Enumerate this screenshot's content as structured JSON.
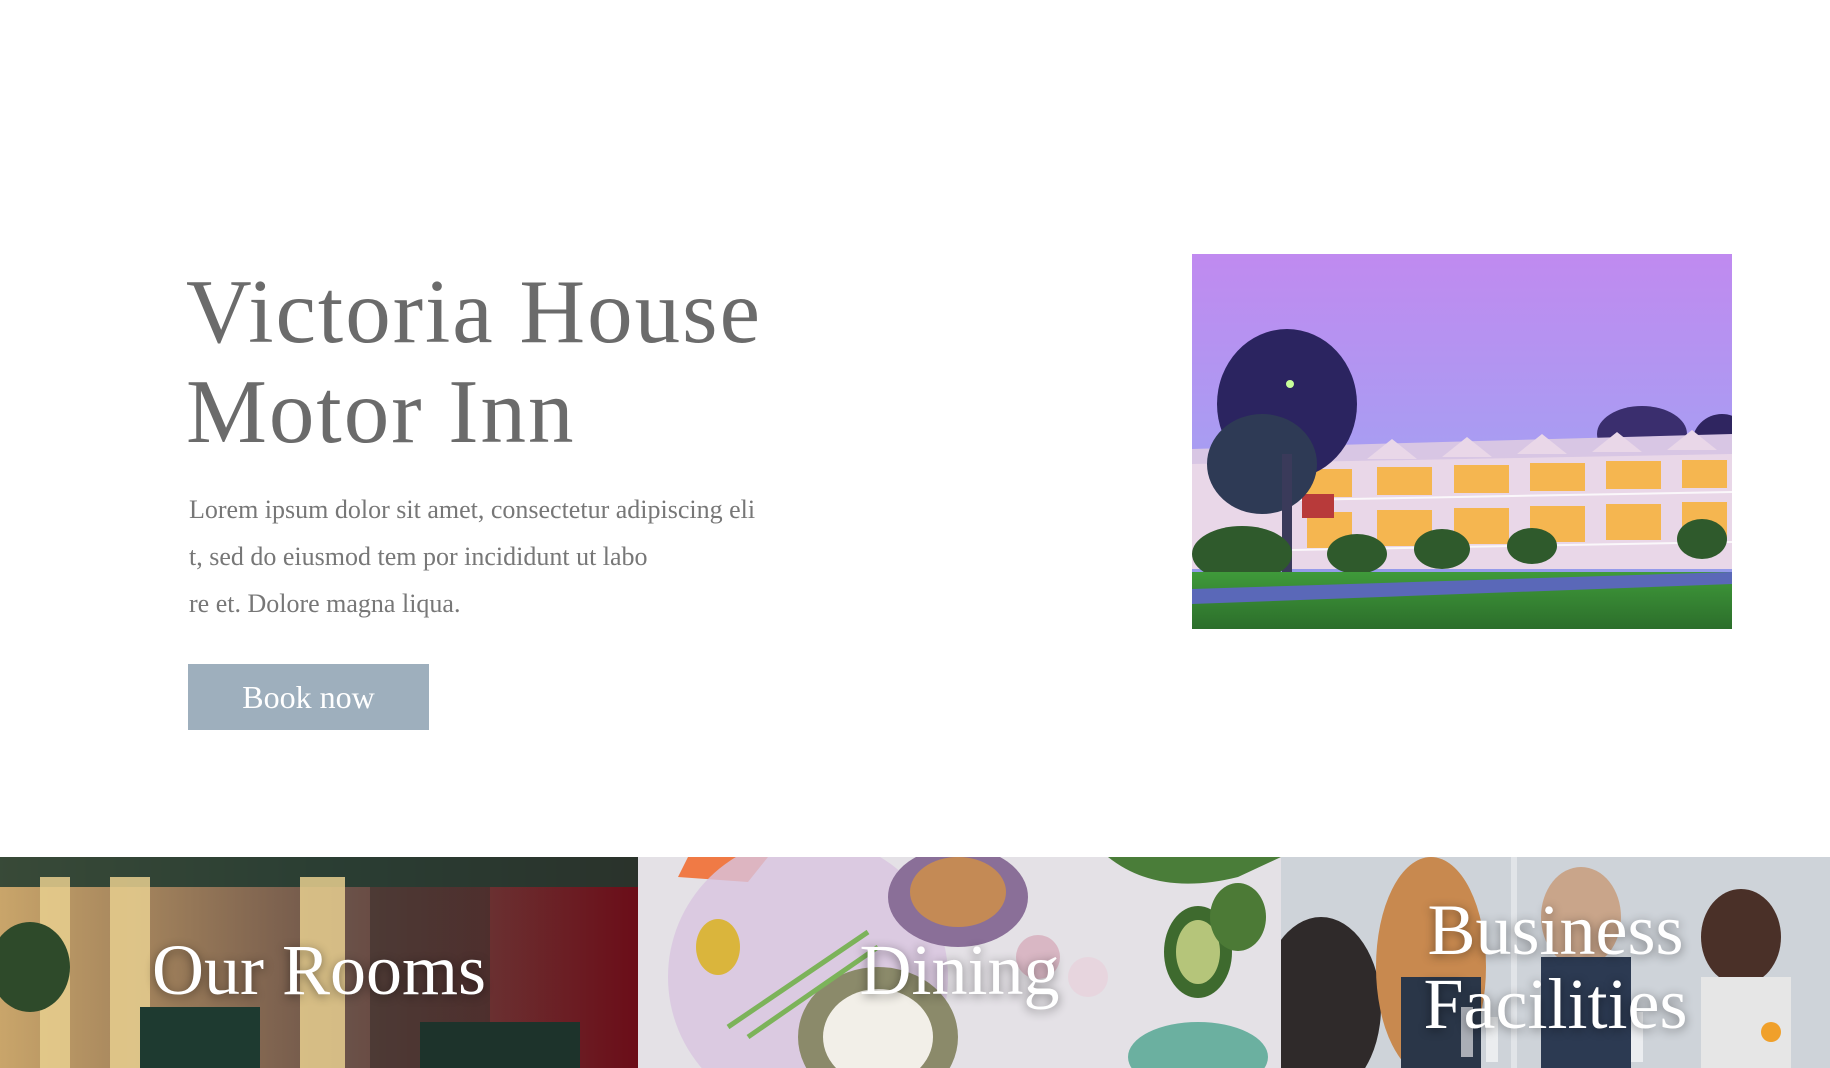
{
  "hero": {
    "title_line1": "Victoria House",
    "title_line2": "Motor Inn",
    "body_line1": "Lorem ipsum dolor sit amet, consectetur adipiscing eli",
    "body_line2": "t, sed do eiusmod tem por incididunt ut labo",
    "body_line3": "re et. Dolore magna liqua.",
    "book_label": "Book now"
  },
  "tiles": [
    {
      "label": "Our Rooms"
    },
    {
      "label": "Dining"
    },
    {
      "label_line1": "Business",
      "label_line2": "Facilities"
    }
  ],
  "colors": {
    "title": "#6b6b6b",
    "body": "#777777",
    "button": "#9eafbd",
    "button_text": "#ffffff"
  }
}
